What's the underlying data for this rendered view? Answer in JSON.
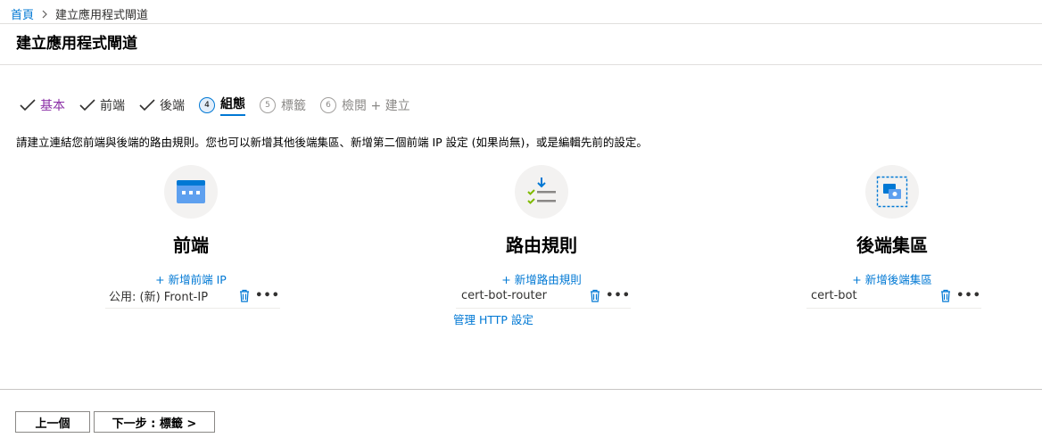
{
  "breadcrumb": {
    "home": "首頁",
    "current": "建立應用程式閘道"
  },
  "page_title": "建立應用程式閘道",
  "wizard": {
    "steps": [
      {
        "label": "基本",
        "state": "done"
      },
      {
        "label": "前端",
        "state": "done"
      },
      {
        "label": "後端",
        "state": "done"
      },
      {
        "number": "4",
        "label": "組態",
        "state": "active"
      },
      {
        "number": "5",
        "label": "標籤",
        "state": "disabled"
      },
      {
        "number": "6",
        "label": "檢閱 + 建立",
        "state": "disabled"
      }
    ]
  },
  "description": "請建立連結您前端與後端的路由規則。您也可以新增其他後端集區、新增第二個前端 IP 設定 (如果尚無)，或是編輯先前的設定。",
  "frontend": {
    "heading": "前端",
    "add_link": "+ 新增前端 IP",
    "item": "公用: (新) Front-IP",
    "icon": "frontend-icon"
  },
  "routing": {
    "heading": "路由規則",
    "add_link": "+ 新增路由規則",
    "item": "cert-bot-router",
    "manage_link": "管理 HTTP 設定",
    "icon": "routing-rules-icon"
  },
  "backend": {
    "heading": "後端集區",
    "add_link": "+ 新增後端集區",
    "item": "cert-bot",
    "icon": "backend-pool-icon"
  },
  "more_glyph": "•••",
  "footer": {
    "prev_label": "上一個",
    "next_label": "下一步 : 標籤 >"
  },
  "colors": {
    "accent": "#0078d4",
    "visited_link": "#8a2da5",
    "check": "#323130",
    "icon_circle": "#f3f2f1",
    "divider": "#e1dfdd"
  }
}
